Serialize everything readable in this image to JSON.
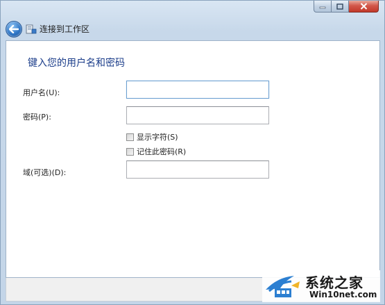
{
  "window": {
    "title": "连接到工作区"
  },
  "form": {
    "heading": "键入您的用户名和密码",
    "username_label": "用户名(U):",
    "username_value": "",
    "password_label": "密码(P):",
    "password_value": "",
    "show_chars_label": "显示字符(S)",
    "show_chars_checked": false,
    "remember_label": "记住此密码(R)",
    "remember_checked": false,
    "domain_label": "域(可选)(D):",
    "domain_value": ""
  },
  "watermark": {
    "brand": "系统之家",
    "site": "Win10net.com"
  },
  "icons": {
    "back": "back-arrow-icon",
    "workplace": "workplace-connection-icon",
    "minimize": "minimize-icon",
    "maximize": "maximize-icon",
    "close": "close-icon"
  },
  "colors": {
    "heading": "#1b3d8a",
    "close_button": "#c2392a",
    "back_button": "#2f76c6"
  }
}
